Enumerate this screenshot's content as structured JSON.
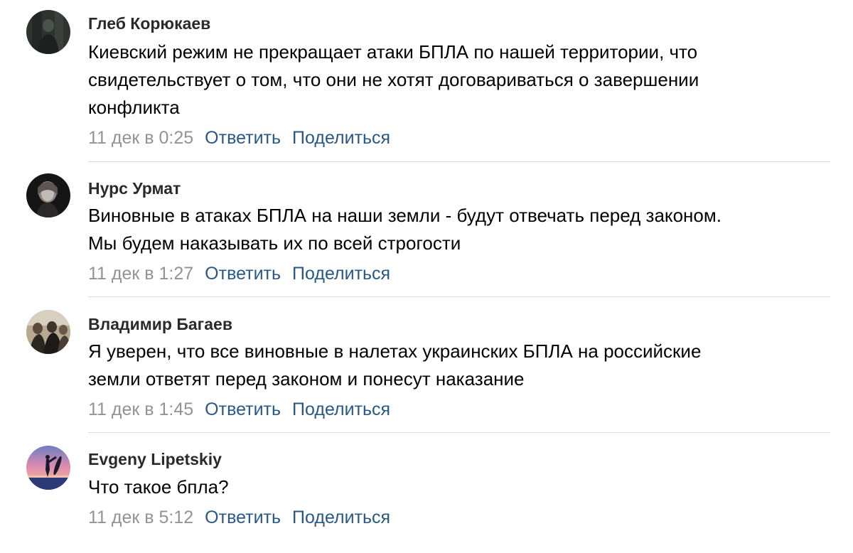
{
  "comments": [
    {
      "author": "Глеб Корюкаев",
      "avatar_icon": "user-avatar-dark",
      "text_lines": [
        "Киевский режим не прекращает атаки БПЛА по нашей территории, что",
        "свидетельствует о том, что они не хотят договариваться о завершении",
        "конфликта"
      ],
      "date": "11 дек в 0:25",
      "reply_label": "Ответить",
      "share_label": "Поделиться"
    },
    {
      "author": "Нурс Урмат",
      "avatar_icon": "user-avatar-portrait",
      "text_lines": [
        "Виновные в атаках БПЛА на наши земли - будут отвечать перед законом.",
        "Мы будем наказывать их по всей строгости"
      ],
      "date": "11 дек в 1:27",
      "reply_label": "Ответить",
      "share_label": "Поделиться"
    },
    {
      "author": "Владимир Багаев",
      "avatar_icon": "user-avatar-group-photo",
      "text_lines": [
        "Я уверен, что все виновные в налетах украинских БПЛА на российские",
        "земли ответят перед законом и понесут наказание"
      ],
      "date": "11 дек в 1:45",
      "reply_label": "Ответить",
      "share_label": "Поделиться"
    },
    {
      "author": "Evgeny Lipetskiy",
      "avatar_icon": "user-avatar-surfer-sunset",
      "text_lines": [
        "Что такое бпла?"
      ],
      "date": "11 дек в 5:12",
      "reply_label": "Ответить",
      "share_label": "Поделиться"
    }
  ],
  "colors": {
    "link": "#2a5885",
    "date": "#939393",
    "divider": "#dcdcdc"
  }
}
